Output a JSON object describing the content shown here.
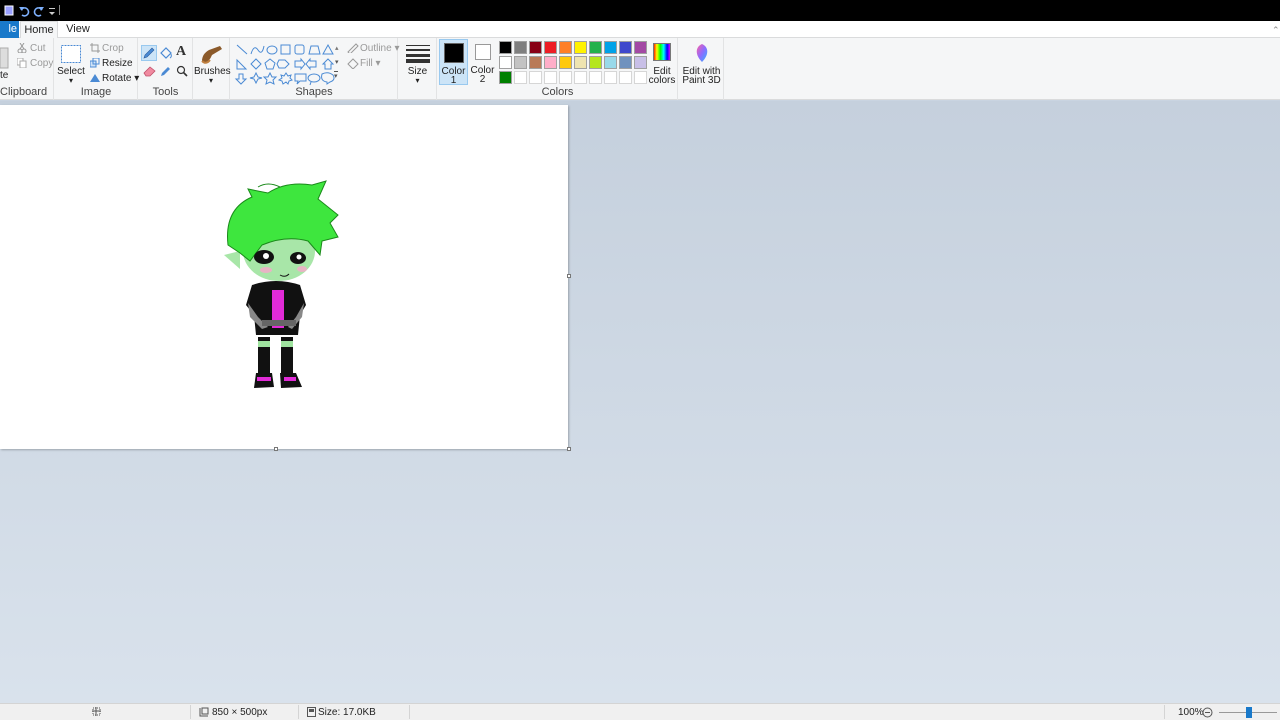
{
  "tabs": {
    "file": "le",
    "home": "Home",
    "view": "View"
  },
  "clipboard": {
    "paste": "te",
    "cut": "Cut",
    "copy": "Copy",
    "label": "Clipboard"
  },
  "image": {
    "select": "Select",
    "crop": "Crop",
    "resize": "Resize",
    "rotate": "Rotate",
    "label": "Image"
  },
  "tools": {
    "label": "Tools",
    "text_glyph": "A"
  },
  "brushes": {
    "label": "Brushes"
  },
  "shapes": {
    "outline": "Outline",
    "fill": "Fill",
    "label": "Shapes"
  },
  "size": {
    "label": "Size"
  },
  "colors": {
    "color1_line1": "Color",
    "color1_line2": "1",
    "color2_line1": "Color",
    "color2_line2": "2",
    "label": "Colors",
    "edit_line1": "Edit",
    "edit_line2": "colors",
    "paint3d_line1": "Edit with",
    "paint3d_line2": "Paint 3D",
    "color1_value": "#000000",
    "color2_value": "#ffffff",
    "row1": [
      "#000000",
      "#7f7f7f",
      "#880015",
      "#ed1c24",
      "#ff7f27",
      "#fff200",
      "#22b14c",
      "#00a2e8",
      "#3f48cc",
      "#a349a4"
    ],
    "row2": [
      "#ffffff",
      "#c3c3c3",
      "#b97a57",
      "#ffaec9",
      "#ffc90e",
      "#efe4b0",
      "#b5e61d",
      "#99d9ea",
      "#7092be",
      "#c8bfe7"
    ],
    "row3": [
      "#008000"
    ]
  },
  "status": {
    "dimensions": "850 × 500px",
    "size": "Size: 17.0KB",
    "zoom": "100%"
  }
}
